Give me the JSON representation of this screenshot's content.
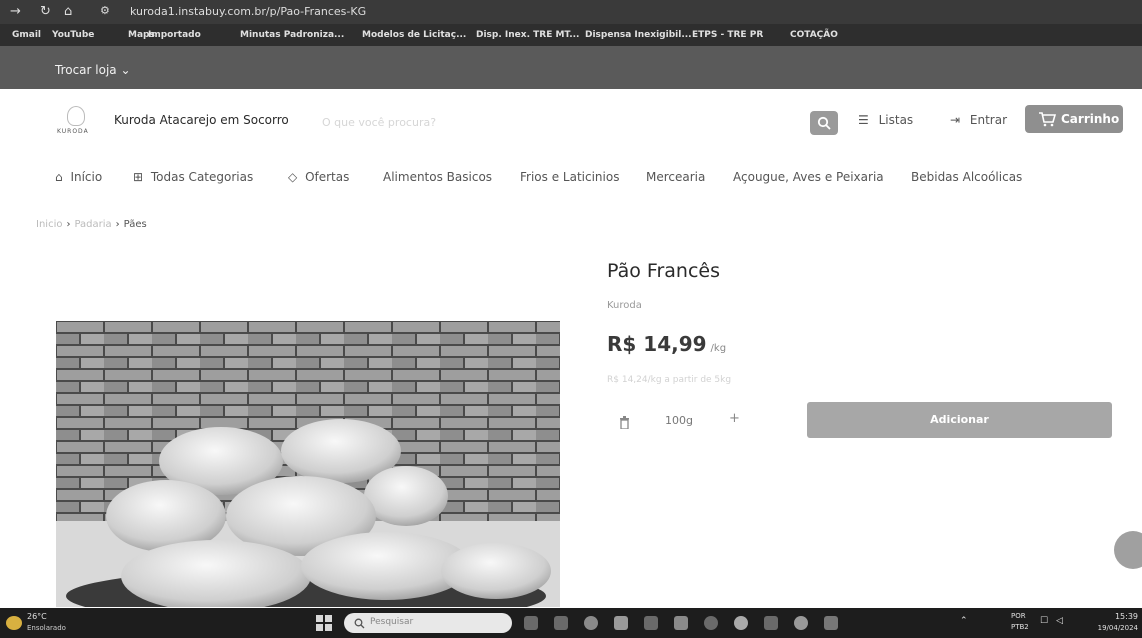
{
  "browser": {
    "url": "kuroda1.instabuy.com.br/p/Pao-Frances-KG",
    "bookmarks": [
      "Gmail",
      "YouTube",
      "Maps",
      "Importado",
      "Minutas Padroniza...",
      "Modelos de Licitaç...",
      "Disp. Inex. TRE MT...",
      "Dispensa Inexigibil...",
      "ETPS - TRE PR",
      "COTAÇÃO"
    ]
  },
  "storebar": {
    "switch_label": "Trocar loja"
  },
  "header": {
    "logo_text": "KURODA",
    "store_name": "Kuroda Atacarejo em Socorro",
    "search_placeholder": "O que você procura?",
    "lists_label": "Listas",
    "login_label": "Entrar",
    "cart_label": "Carrinho"
  },
  "nav": {
    "items": [
      "Início",
      "Todas Categorias",
      "Ofertas",
      "Alimentos Basicos",
      "Frios e Laticinios",
      "Mercearia",
      "Açougue, Aves e Peixaria",
      "Bebidas Alcoólicas"
    ]
  },
  "breadcrumb": [
    "Inicio",
    "Padaria",
    "Pães"
  ],
  "product": {
    "title": "Pão Francês",
    "brand": "Kuroda",
    "price": "R$ 14,99",
    "price_unit": "/kg",
    "bulk_price": "R$ 14,24/kg a partir de 5kg",
    "quantity": "100g",
    "add_label": "Adicionar"
  },
  "taskbar": {
    "weather_temp": "26°C",
    "weather_desc": "Ensolarado",
    "search_label": "Pesquisar",
    "lang_1": "POR",
    "lang_2": "PTB2",
    "time": "15:39",
    "date": "19/04/2024"
  }
}
